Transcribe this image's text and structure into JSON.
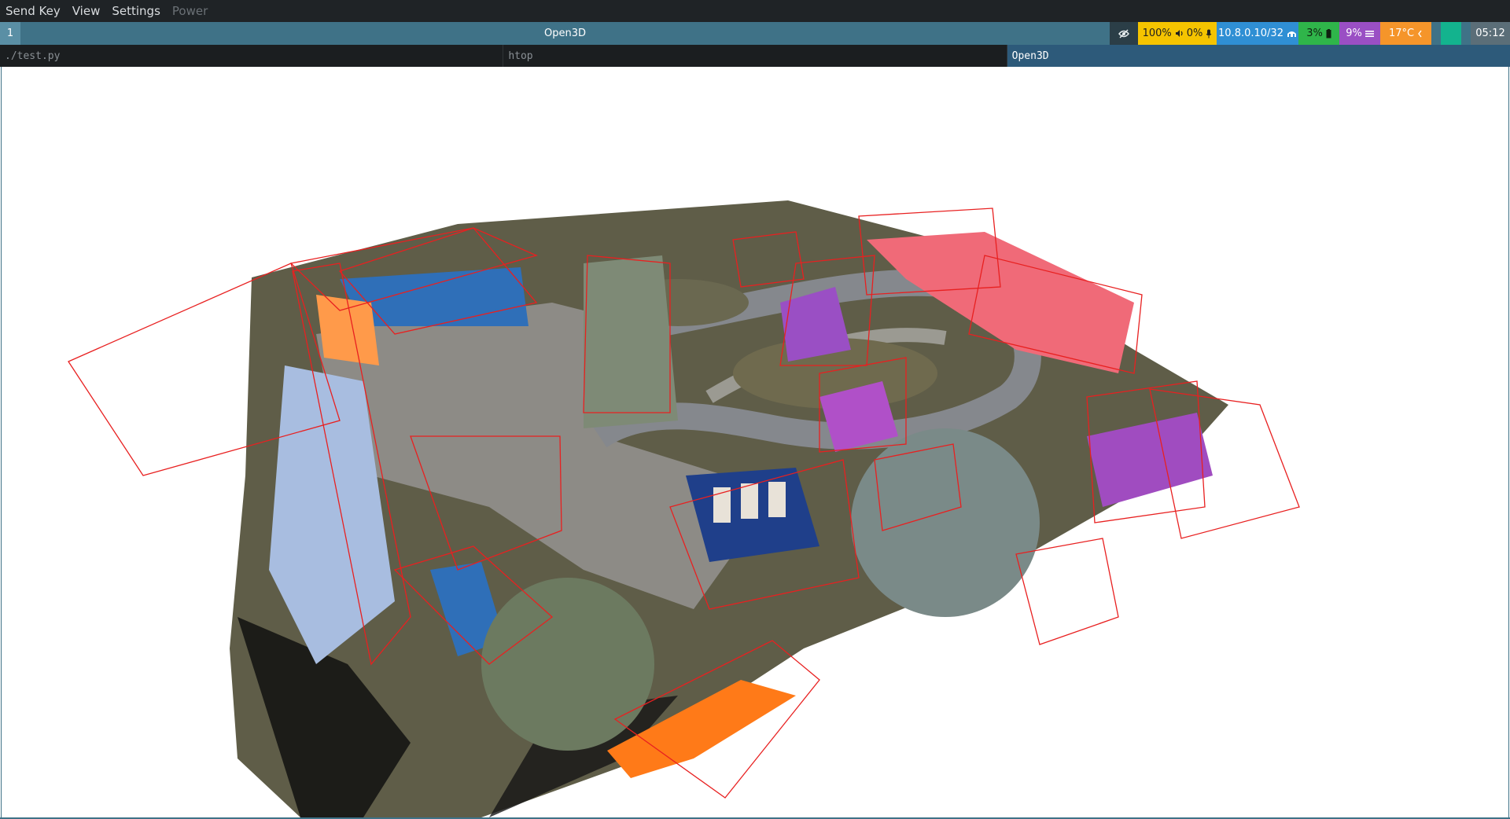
{
  "menubar": {
    "items": [
      {
        "label": "Send Key",
        "enabled": true
      },
      {
        "label": "View",
        "enabled": true
      },
      {
        "label": "Settings",
        "enabled": true
      },
      {
        "label": "Power",
        "enabled": false
      }
    ]
  },
  "statusbar": {
    "workspace": "1",
    "window_title": "Open3D",
    "privacy_icon": "eye-slash-icon",
    "volume": "100%",
    "volume_icon": "speaker-icon",
    "mic": "0%",
    "mic_icon": "microphone-icon",
    "network": "10.8.0.10/32",
    "network_icon": "network-icon",
    "memory": "3%",
    "memory_icon": "memory-icon",
    "cpu": "9%",
    "cpu_icon": "cpu-bars-icon",
    "temperature": "17°C",
    "temperature_icon": "chevron-left-icon",
    "clock": "05:12",
    "colors": {
      "bar": "#3f7287",
      "audio": "#f5c400",
      "network": "#2f8fd4",
      "memory": "#2fb54a",
      "cpu": "#9a4fc4",
      "temperature": "#f5952a",
      "indicator": "#13b38e"
    }
  },
  "tabs": [
    {
      "label": "./test.py",
      "active": false
    },
    {
      "label": "htop",
      "active": false
    },
    {
      "label": "Open3D",
      "active": true
    }
  ],
  "viewport": {
    "content": "Open3D point cloud render of an outdoor courtyard with red 3D bounding boxes and colored segmentation",
    "colors": {
      "background": "#ffffff",
      "bounding_box": "#e82020",
      "segment_blue": "#2f6fb8",
      "segment_pink": "#f06a78",
      "segment_purple": "#a04cc0",
      "segment_orange": "#ff7a18",
      "segment_lightblue": "#a8bde0",
      "road": "#8c8f94",
      "grass": "#6c6a52"
    }
  }
}
